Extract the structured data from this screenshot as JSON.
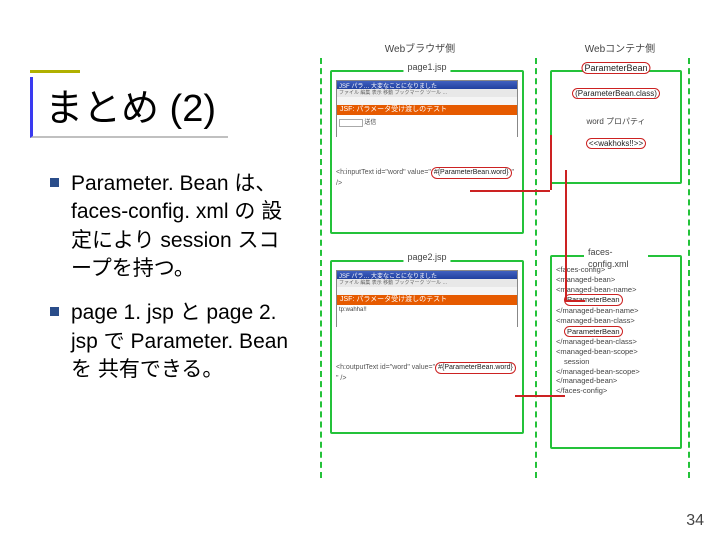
{
  "title": "まとめ (2)",
  "bullets": [
    "Parameter. Bean は、 faces-config. xml の 設定により session スコープを持つ。",
    "page 1. jsp と page 2. jsp で Parameter. Bean を 共有できる。"
  ],
  "diagram": {
    "col_left": "Webブラウザ側",
    "col_right": "Webコンテナ側",
    "page1": {
      "title": "page1.jsp",
      "titlebar": "JSF パラ… 大変なことになりました",
      "menubar": "ファイル 編集 表示 移動 ブックマーク ツール …",
      "banner": "JSF: パラメータ受け渡しのテスト",
      "body": "送信",
      "code_pre": "<h:inputText id=\"word\"\n  value=\"",
      "code_hl": "#{ParameterBean.word}",
      "code_post": "\"\n/>"
    },
    "page2": {
      "title": "page2.jsp",
      "titlebar": "JSF パラ… 大変なことになりました",
      "menubar": "ファイル 編集 表示 移動 ブックマーク ツール …",
      "banner": "JSF: パラメータ受け渡しのテスト",
      "body": "tp:wahha!!",
      "code_pre": "<h:outputText id=\"word\"\n  value=\"",
      "code_hl": "#{ParameterBean.word}",
      "code_post": "\"\n/>"
    },
    "bean": {
      "title": "ParameterBean",
      "line1": "(ParameterBean.class)",
      "line2": "word プロパティ",
      "line3": "<<wakhoks!!>>"
    },
    "config": {
      "title": "faces-config.xml",
      "l1": "<faces-config>",
      "l2": "<managed-bean>",
      "l3": "<managed-bean-name>",
      "hl1": "ParameterBean",
      "l4": "</managed-bean-name>",
      "l5": "<managed-bean-class>",
      "hl2": "ParameterBean",
      "l6": "</managed-bean-class>",
      "l7": "<managed-bean-scope>",
      "l8": "session",
      "l9": "</managed-bean-scope>",
      "l10": "</managed-bean>",
      "l11": "</faces-config>"
    }
  },
  "page_number": "34"
}
